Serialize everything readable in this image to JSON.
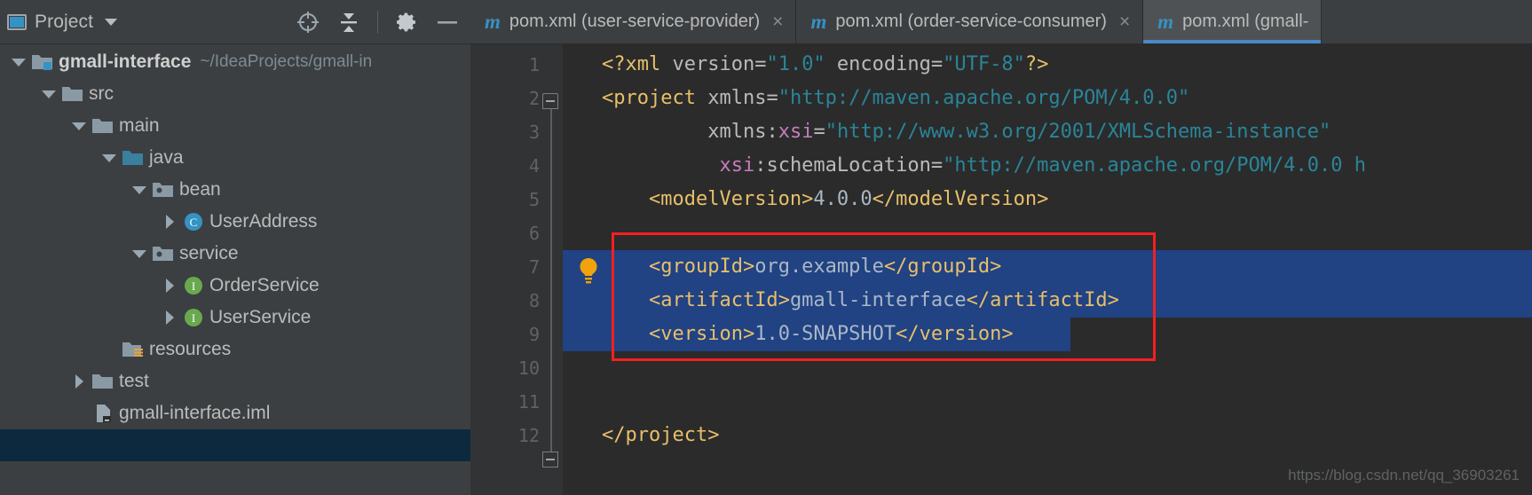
{
  "project_panel": {
    "title": "Project",
    "window_icon": "project-window-icon",
    "dropdown_icon": "chevron-down-icon",
    "toolbar": [
      {
        "name": "locate-icon",
        "label": "Select Opened File"
      },
      {
        "name": "collapse-all-icon",
        "label": "Collapse All"
      },
      {
        "name": "gear-icon",
        "label": "Settings"
      },
      {
        "name": "minimize-icon",
        "label": "Hide"
      }
    ],
    "tree": [
      {
        "label": "gmall-interface",
        "sub": "~/IdeaProjects/gmall-in",
        "icon": "module-folder-icon",
        "twisty": "down",
        "depth": 0,
        "bold": true,
        "selected": false
      },
      {
        "label": "src",
        "sub": "",
        "icon": "folder-icon",
        "twisty": "down",
        "depth": 1,
        "bold": false,
        "selected": false
      },
      {
        "label": "main",
        "sub": "",
        "icon": "folder-icon",
        "twisty": "down",
        "depth": 2,
        "bold": false,
        "selected": false
      },
      {
        "label": "java",
        "sub": "",
        "icon": "source-root-folder-icon",
        "twisty": "down",
        "depth": 3,
        "bold": false,
        "selected": false
      },
      {
        "label": "bean",
        "sub": "",
        "icon": "package-folder-icon",
        "twisty": "down",
        "depth": 4,
        "bold": false,
        "selected": false
      },
      {
        "label": "UserAddress",
        "sub": "",
        "icon": "java-class-icon",
        "twisty": "right",
        "depth": 5,
        "bold": false,
        "selected": false
      },
      {
        "label": "service",
        "sub": "",
        "icon": "package-folder-icon",
        "twisty": "down",
        "depth": 4,
        "bold": false,
        "selected": false
      },
      {
        "label": "OrderService",
        "sub": "",
        "icon": "java-interface-icon",
        "twisty": "right",
        "depth": 5,
        "bold": false,
        "selected": false
      },
      {
        "label": "UserService",
        "sub": "",
        "icon": "java-interface-icon",
        "twisty": "right",
        "depth": 5,
        "bold": false,
        "selected": false
      },
      {
        "label": "resources",
        "sub": "",
        "icon": "resources-folder-icon",
        "twisty": "none",
        "depth": 3,
        "bold": false,
        "selected": false
      },
      {
        "label": "test",
        "sub": "",
        "icon": "folder-icon",
        "twisty": "right",
        "depth": 2,
        "bold": false,
        "selected": false
      },
      {
        "label": "gmall-interface.iml",
        "sub": "",
        "icon": "iml-file-icon",
        "twisty": "none",
        "depth": 2,
        "bold": false,
        "selected": false
      },
      {
        "label": "",
        "sub": "",
        "icon": "none",
        "twisty": "none",
        "depth": 2,
        "bold": false,
        "selected": true
      }
    ]
  },
  "editor": {
    "tabs": [
      {
        "label": "pom.xml (user-service-provider)",
        "icon": "maven-m-icon",
        "close": "×",
        "active": false
      },
      {
        "label": "pom.xml (order-service-consumer)",
        "icon": "maven-m-icon",
        "close": "×",
        "active": false
      },
      {
        "label": "pom.xml (gmall-",
        "icon": "maven-m-icon",
        "close": "",
        "active": true
      }
    ],
    "line_numbers": [
      "1",
      "2",
      "3",
      "4",
      "5",
      "6",
      "7",
      "8",
      "9",
      "10",
      "11",
      "12"
    ],
    "lines": [
      {
        "n": 1,
        "tokens": [
          {
            "t": "tag",
            "s": "<?xml "
          },
          {
            "t": "attr",
            "s": "version="
          },
          {
            "t": "val",
            "s": "\"1.0\""
          },
          {
            "t": "attr",
            "s": " encoding="
          },
          {
            "t": "val",
            "s": "\"UTF-8\""
          },
          {
            "t": "tag",
            "s": "?>"
          }
        ]
      },
      {
        "n": 2,
        "tokens": [
          {
            "t": "tag",
            "s": "<project "
          },
          {
            "t": "attr",
            "s": "xmlns="
          },
          {
            "t": "val",
            "s": "\"http://maven.apache.org/POM/4.0.0\""
          }
        ]
      },
      {
        "n": 3,
        "tokens": [
          {
            "t": "txt",
            "s": "         "
          },
          {
            "t": "attr",
            "s": "xmlns:"
          },
          {
            "t": "ns",
            "s": "xsi"
          },
          {
            "t": "attr",
            "s": "="
          },
          {
            "t": "val",
            "s": "\"http://www.w3.org/2001/XMLSchema-instance\""
          }
        ]
      },
      {
        "n": 4,
        "tokens": [
          {
            "t": "txt",
            "s": "          "
          },
          {
            "t": "ns",
            "s": "xsi"
          },
          {
            "t": "attr",
            "s": ":schemaLocation="
          },
          {
            "t": "val",
            "s": "\"http://maven.apache.org/POM/4.0.0 h"
          }
        ]
      },
      {
        "n": 5,
        "tokens": [
          {
            "t": "txt",
            "s": "    "
          },
          {
            "t": "tag",
            "s": "<modelVersion>"
          },
          {
            "t": "txt",
            "s": "4.0.0"
          },
          {
            "t": "tag",
            "s": "</modelVersion>"
          }
        ]
      },
      {
        "n": 6,
        "tokens": []
      },
      {
        "n": 7,
        "tokens": [
          {
            "t": "txt",
            "s": "    "
          },
          {
            "t": "tag",
            "s": "<groupId>"
          },
          {
            "t": "txt",
            "s": "org.example"
          },
          {
            "t": "tag",
            "s": "</groupId>"
          }
        ]
      },
      {
        "n": 8,
        "tokens": [
          {
            "t": "txt",
            "s": "    "
          },
          {
            "t": "tag",
            "s": "<artifactId>"
          },
          {
            "t": "txt",
            "s": "gmall-interface"
          },
          {
            "t": "tag",
            "s": "</artifactId>"
          }
        ]
      },
      {
        "n": 9,
        "tokens": [
          {
            "t": "txt",
            "s": "    "
          },
          {
            "t": "tag",
            "s": "<version>"
          },
          {
            "t": "txt",
            "s": "1.0-SNAPSHOT"
          },
          {
            "t": "tag",
            "s": "</version>"
          }
        ]
      },
      {
        "n": 10,
        "tokens": []
      },
      {
        "n": 11,
        "tokens": []
      },
      {
        "n": 12,
        "tokens": [
          {
            "t": "tag",
            "s": "</project>"
          }
        ]
      }
    ],
    "annotation": {
      "name": "red-highlight-box",
      "color": "#f42020"
    },
    "intention_bulb": {
      "name": "intention-bulb-icon",
      "color": "#f0a30a"
    },
    "selection_color": "#214283",
    "watermark": "https://blog.csdn.net/qq_36903261"
  },
  "colors": {
    "tag": "#e8bf6a",
    "attr": "#bababa",
    "namespace": "#c77dbb",
    "value": "#2a8599",
    "text": "#a9b7c6",
    "accent": "#3592c4",
    "panel_bg": "#3c3f41",
    "editor_bg": "#2b2b2b"
  }
}
